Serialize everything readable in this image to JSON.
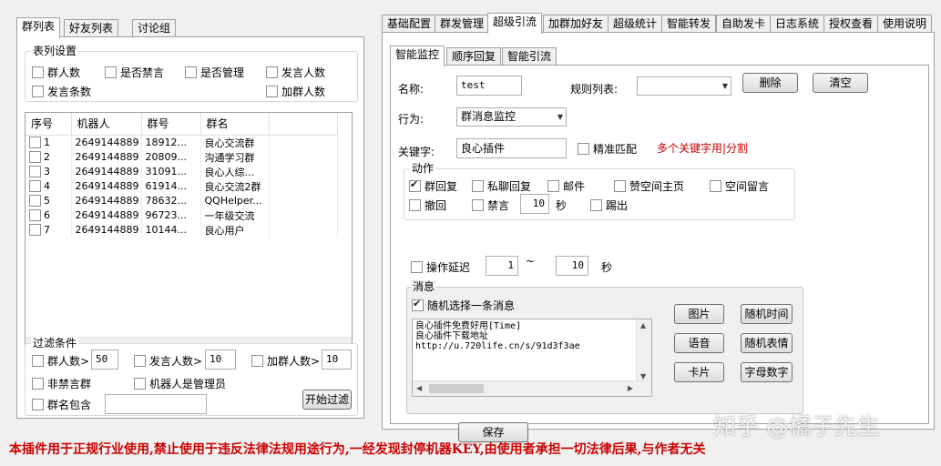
{
  "left": {
    "tabs": [
      "群列表",
      "好友列表",
      "讨论组"
    ],
    "table_settings": {
      "title": "表列设置",
      "options": [
        "群人数",
        "是否禁言",
        "是否管理",
        "发言人数",
        "发言条数",
        "加群人数"
      ]
    },
    "grid": {
      "columns": [
        "序号",
        "机器人",
        "群号",
        "群名"
      ],
      "rows": [
        {
          "idx": "1",
          "bot": "2649144889",
          "group_no": "18912...",
          "name": "良心交流群"
        },
        {
          "idx": "2",
          "bot": "2649144889",
          "group_no": "20809...",
          "name": "沟通学习群"
        },
        {
          "idx": "3",
          "bot": "2649144889",
          "group_no": "31091...",
          "name": "良心人综..."
        },
        {
          "idx": "4",
          "bot": "2649144889",
          "group_no": "61914...",
          "name": "良心交流2群"
        },
        {
          "idx": "5",
          "bot": "2649144889",
          "group_no": "78632...",
          "name": "QQHelper..."
        },
        {
          "idx": "6",
          "bot": "2649144889",
          "group_no": "96723...",
          "name": "一年级交流"
        },
        {
          "idx": "7",
          "bot": "2649144889",
          "group_no": "10144...",
          "name": "良心用户"
        }
      ]
    },
    "filter": {
      "title": "过滤条件",
      "member_label": "群人数>",
      "member_value": "50",
      "speaker_label": "发言人数>",
      "speaker_value": "10",
      "join_label": "加群人数>",
      "join_value": "10",
      "not_muted_label": "非禁言群",
      "bot_admin_label": "机器人是管理员",
      "name_contains_label": "群名包含",
      "name_contains_value": "",
      "start_button": "开始过滤"
    }
  },
  "right": {
    "tabs": [
      "基础配置",
      "群发管理",
      "超级引流",
      "加群加好友",
      "超级统计",
      "智能转发",
      "自助发卡",
      "日志系统",
      "授权查看",
      "使用说明"
    ],
    "subtabs": [
      "智能监控",
      "顺序回复",
      "智能引流"
    ],
    "name_label": "名称:",
    "name_value": "test",
    "rules_label": "规则列表:",
    "rules_value": "",
    "delete_button": "删除",
    "clear_button": "清空",
    "action_label": "行为:",
    "action_value": "群消息监控",
    "keyword_label": "关键字:",
    "keyword_value": "良心插件",
    "exact_match_label": "精准匹配",
    "keyword_hint": "多个关键字用|分割",
    "actions_group": {
      "title": "动作",
      "group_reply": "群回复",
      "private_reply": "私聊回复",
      "email": "邮件",
      "like_zone": "赞空间主页",
      "zone_msg": "空间留言",
      "recall": "撤回",
      "mute": "禁言",
      "mute_value": "10",
      "seconds": "秒",
      "kick": "踢出"
    },
    "delay": {
      "label": "操作延迟",
      "from": "1",
      "tilde": "~",
      "to": "10",
      "unit": "秒"
    },
    "message_group": {
      "title": "消息",
      "random_label": "随机选择一条消息",
      "lines": [
        "良心插件免费好用[Time]",
        "良心插件下载地址",
        "http://u.720life.cn/s/91d3f3ae"
      ],
      "buttons": [
        "图片",
        "随机时间",
        "语音",
        "随机表情",
        "卡片",
        "字母数字"
      ]
    },
    "save_button": "保存"
  },
  "disclaimer": "本插件用于正规行业使用,禁止使用于违反法律法规用途行为,一经发现封停机器KEY,由使用者承担一切法律后果,与作者无关",
  "watermark": "知乎 @橘子先生",
  "colors": {
    "warning": "#cc0000",
    "accent": "#3399ff"
  }
}
